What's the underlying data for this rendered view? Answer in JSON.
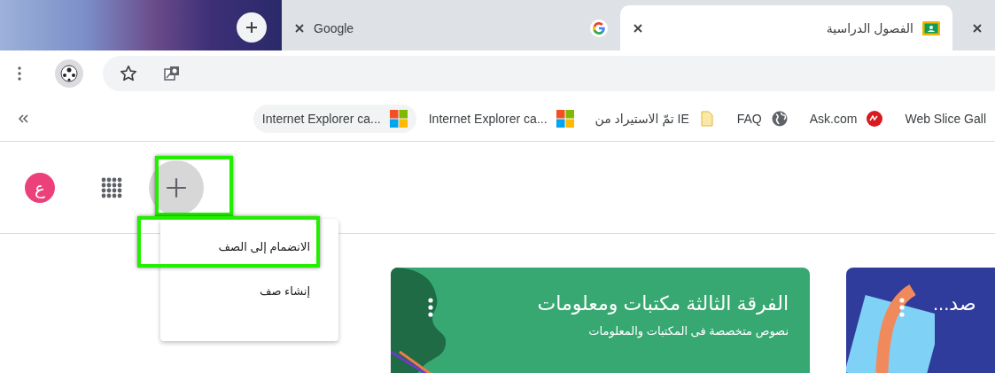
{
  "tabs": [
    {
      "kind": "partial",
      "selected": false
    },
    {
      "kind": "classroom",
      "title": "الفصول الدراسية",
      "selected": true
    },
    {
      "kind": "google",
      "title": "Google",
      "selected": false
    }
  ],
  "bookmarks": [
    {
      "kind": "plain",
      "label": "Web Slice Gall",
      "hovered": false
    },
    {
      "kind": "ask",
      "label": "Ask.com",
      "hovered": false
    },
    {
      "kind": "globe",
      "label": "FAQ",
      "hovered": false
    },
    {
      "kind": "folder",
      "label": "تمّ الاستيراد من IE",
      "hovered": false
    },
    {
      "kind": "windows",
      "label": "Internet Explorer ca...",
      "hovered": false
    },
    {
      "kind": "windows",
      "label": "Internet Explorer ca...",
      "hovered": true
    }
  ],
  "header": {
    "avatar_letter": "ع",
    "add_button": {
      "highlighted": true
    }
  },
  "add_menu": [
    {
      "label": "الانضمام إلى الصف",
      "highlighted": true
    },
    {
      "label": "إنشاء صف",
      "highlighted": false
    }
  ],
  "classes": [
    {
      "kind": "blue",
      "title": "صد..."
    },
    {
      "kind": "green",
      "title": "الفرقة الثالثة مكتبات ومعلومات",
      "subtitle": "نصوص متخصصة فى المكتبات والمعلومات"
    }
  ]
}
